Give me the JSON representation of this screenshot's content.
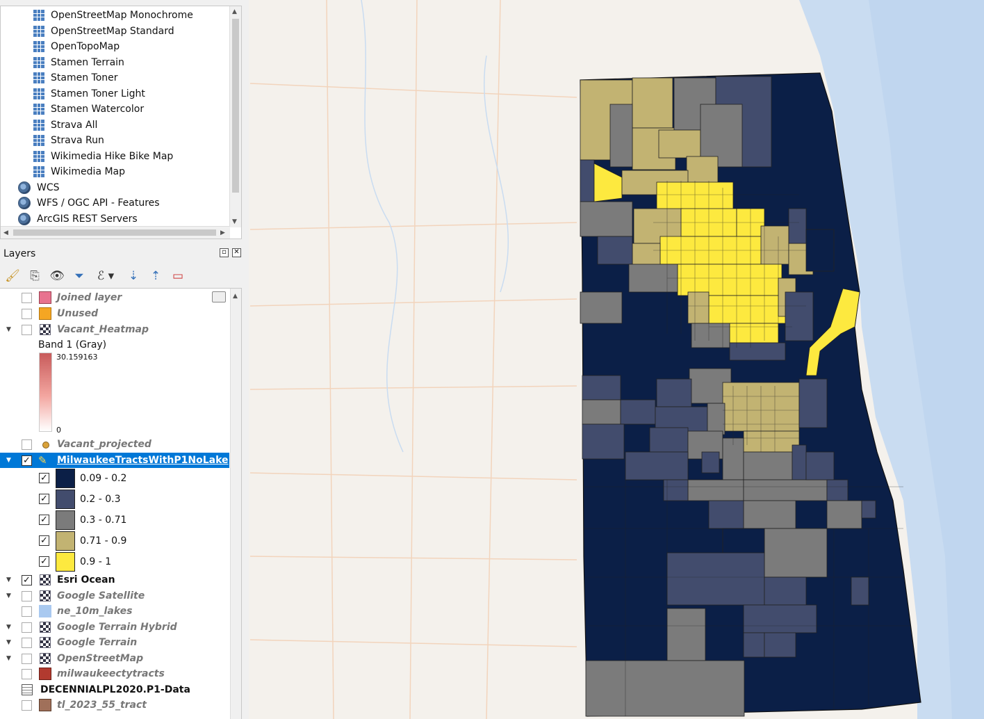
{
  "browser": {
    "items": [
      {
        "label": "OpenStreetMap Monochrome",
        "icon": "xyz-tile-icon"
      },
      {
        "label": "OpenStreetMap Standard",
        "icon": "xyz-tile-icon"
      },
      {
        "label": "OpenTopoMap",
        "icon": "xyz-tile-icon"
      },
      {
        "label": "Stamen Terrain",
        "icon": "xyz-tile-icon"
      },
      {
        "label": "Stamen Toner",
        "icon": "xyz-tile-icon"
      },
      {
        "label": "Stamen Toner Light",
        "icon": "xyz-tile-icon"
      },
      {
        "label": "Stamen Watercolor",
        "icon": "xyz-tile-icon"
      },
      {
        "label": "Strava All",
        "icon": "xyz-tile-icon"
      },
      {
        "label": "Strava Run",
        "icon": "xyz-tile-icon"
      },
      {
        "label": "Wikimedia Hike Bike Map",
        "icon": "xyz-tile-icon"
      },
      {
        "label": "Wikimedia Map",
        "icon": "xyz-tile-icon"
      }
    ],
    "services": [
      {
        "label": "WCS",
        "icon": "wcs-globe-icon"
      },
      {
        "label": "WFS / OGC API - Features",
        "icon": "wfs-globe-icon"
      },
      {
        "label": "ArcGIS REST Servers",
        "icon": "arcgis-globe-icon"
      }
    ]
  },
  "layers_panel": {
    "title": "Layers",
    "toolbar": [
      "paint-brush-icon",
      "add-group-icon",
      "eye-icon",
      "filter-icon",
      "expression-filter-icon",
      "expand-all-icon",
      "collapse-all-icon",
      "remove-layer-icon"
    ],
    "items": {
      "joined": "Joined layer",
      "unused": "Unused",
      "vacant_heatmap": "Vacant_Heatmap",
      "band": "Band 1 (Gray)",
      "band_max": "30.159163",
      "band_min": "0",
      "vacant_projected": "Vacant_projected",
      "milwaukee": "MilwaukeeTractsWithP1NoLake",
      "esri_ocean": "Esri Ocean",
      "google_satellite": "Google Satellite",
      "ne_lakes": "ne_10m_lakes",
      "google_hybrid": "Google Terrain Hybrid",
      "google_terrain": "Google Terrain",
      "openstreetmap": "OpenStreetMap",
      "milwaukeecty": "milwaukeectytracts",
      "decennial": "DECENNIALPL2020.P1-Data",
      "tl2023": "tl_2023_55_tract"
    },
    "legend": [
      {
        "label": "0.09 - 0.2",
        "color": "#0b1f47"
      },
      {
        "label": "0.2 - 0.3",
        "color": "#424c6d"
      },
      {
        "label": "0.3 - 0.71",
        "color": "#7b7b7b"
      },
      {
        "label": "0.71 - 0.9",
        "color": "#c2b372"
      },
      {
        "label": "0.9 - 1",
        "color": "#fde93f"
      }
    ]
  },
  "colors": {
    "selected_row": "#0078d7",
    "joined_swatch": "#e8738f",
    "unused_swatch": "#f5a623",
    "lakes_swatch": "#a9c9f0",
    "tl_swatch": "#a0705a",
    "lake_water": "#c9dcf1",
    "land": "#f4f1ec"
  }
}
